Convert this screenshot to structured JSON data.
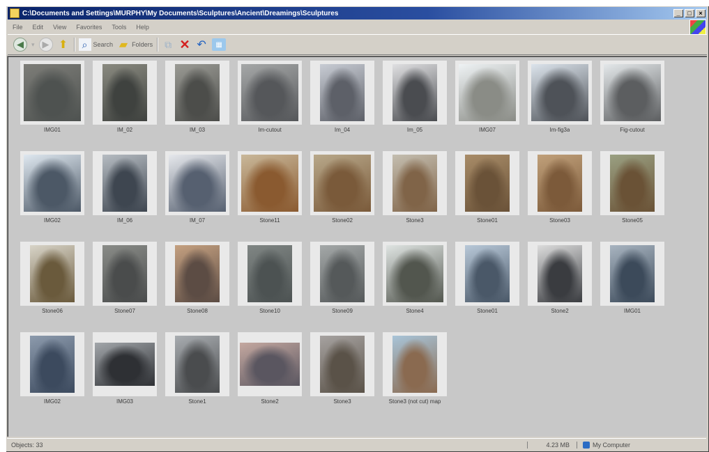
{
  "window": {
    "title": "C:\\Documents and Settings\\MURPHY\\My Documents\\Sculptures\\Ancient\\Dreamings\\Sculptures",
    "controls": [
      "_",
      "□",
      "×"
    ]
  },
  "menubar": [
    "File",
    "Edit",
    "View",
    "Favorites",
    "Tools",
    "Help"
  ],
  "toolbar": {
    "back_icon": "back-arrow-icon",
    "forward_icon": "forward-arrow-icon",
    "search_label": "Search",
    "folders_label": "Folders"
  },
  "thumbnails": [
    {
      "name": "IMG01",
      "c1": "#7d7d78",
      "c2": "#4e5250"
    },
    {
      "name": "IM_02",
      "c1": "#8a8a80",
      "c2": "#3f423f"
    },
    {
      "name": "IM_03",
      "c1": "#9a9a94",
      "c2": "#4c4d4a"
    },
    {
      "name": "Im-cutout",
      "c1": "#a6a8a8",
      "c2": "#55575a"
    },
    {
      "name": "Im_04",
      "c1": "#c8ccd4",
      "c2": "#5d6068"
    },
    {
      "name": "Im_05",
      "c1": "#e0e0e2",
      "c2": "#4a4c50"
    },
    {
      "name": "IMG07",
      "c1": "#eef2f4",
      "c2": "#8a8c86"
    },
    {
      "name": "Im-fig3a",
      "c1": "#dce4ec",
      "c2": "#4e5258"
    },
    {
      "name": "Fig-cutout",
      "c1": "#e4e8ea",
      "c2": "#5c5e60"
    },
    {
      "name": "IMG02",
      "c1": "#dfe8f0",
      "c2": "#4c5866"
    },
    {
      "name": "IM_06",
      "c1": "#b6bcc2",
      "c2": "#3e4650"
    },
    {
      "name": "IM_07",
      "c1": "#e6e8ec",
      "c2": "#566070"
    },
    {
      "name": "Stone11",
      "c1": "#c9b89a",
      "c2": "#8a5a30"
    },
    {
      "name": "Stone02",
      "c1": "#b8a88a",
      "c2": "#7a5a3a"
    },
    {
      "name": "Stone3",
      "c1": "#c4beb0",
      "c2": "#806448"
    },
    {
      "name": "Stone01",
      "c1": "#a88c68",
      "c2": "#6a5238"
    },
    {
      "name": "Stone03",
      "c1": "#c0a07a",
      "c2": "#7c5a3a"
    },
    {
      "name": "Stone05",
      "c1": "#9aa082",
      "c2": "#6a5236"
    },
    {
      "name": "Stone06",
      "c1": "#d8d4c8",
      "c2": "#6a5a3c"
    },
    {
      "name": "Stone07",
      "c1": "#8a8c88",
      "c2": "#4a4c4c"
    },
    {
      "name": "Stone08",
      "c1": "#c4a080",
      "c2": "#5c4c44"
    },
    {
      "name": "Stone10",
      "c1": "#808684",
      "c2": "#4c5252"
    },
    {
      "name": "Stone09",
      "c1": "#a4a8a8",
      "c2": "#55595a"
    },
    {
      "name": "Stone4",
      "c1": "#dfe4e2",
      "c2": "#52564e"
    },
    {
      "name": "Stone01",
      "c1": "#b8c8d8",
      "c2": "#4a5868"
    },
    {
      "name": "Stone2",
      "c1": "#dcdcdc",
      "c2": "#3a3c40"
    },
    {
      "name": "IMG01",
      "c1": "#a8b4c0",
      "c2": "#3c4a5a"
    },
    {
      "name": "IMG02",
      "c1": "#8c9aac",
      "c2": "#3c4a5e"
    },
    {
      "name": "IMG03",
      "c1": "#a2a6aa",
      "c2": "#2e3034"
    },
    {
      "name": "Stone1",
      "c1": "#a8acb0",
      "c2": "#4a4c4e"
    },
    {
      "name": "Stone2",
      "c1": "#c4a8a0",
      "c2": "#5a5660"
    },
    {
      "name": "Stone3",
      "c1": "#a6a2a0",
      "c2": "#5a5248"
    },
    {
      "name": "Stone3 (not cut) map",
      "c1": "#a8c4d8",
      "c2": "#8a6a50"
    }
  ],
  "statusbar": {
    "objects": "Objects: 33",
    "size": "4.23 MB",
    "zone": "My Computer"
  }
}
